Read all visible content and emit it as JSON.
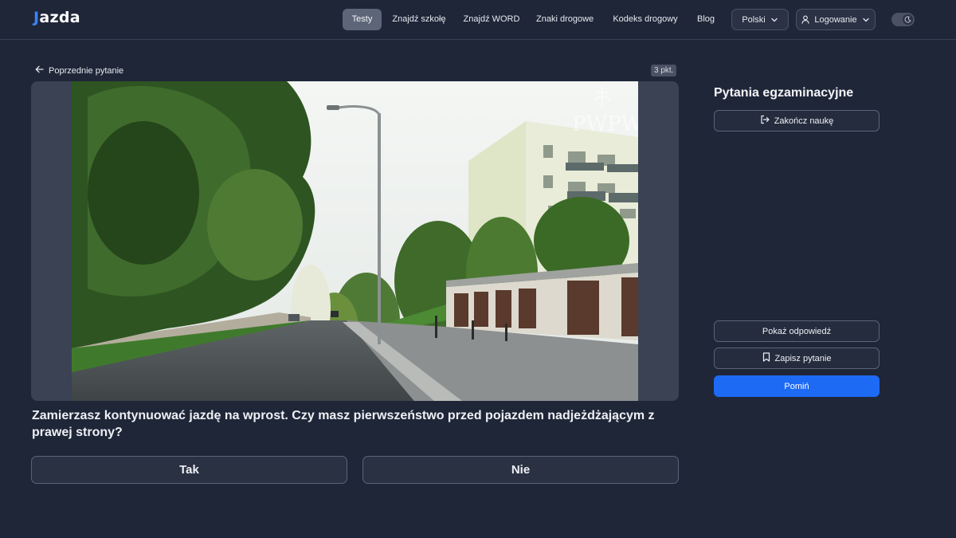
{
  "header": {
    "logo": {
      "prefix": "J",
      "rest": "azda"
    },
    "nav": [
      {
        "label": "Testy",
        "active": true
      },
      {
        "label": "Znajdź szkołę",
        "active": false
      },
      {
        "label": "Znajdź WORD",
        "active": false
      },
      {
        "label": "Znaki drogowe",
        "active": false
      },
      {
        "label": "Kodeks drogowy",
        "active": false
      },
      {
        "label": "Blog",
        "active": false
      }
    ],
    "language": "Polski",
    "login": "Logowanie",
    "theme": "dark"
  },
  "question_view": {
    "back_label": "Poprzednie pytanie",
    "points": "3 pkt.",
    "media_watermark": "PWPW",
    "question": "Zamierzasz kontynuować jazdę na wprost. Czy masz pierwszeństwo przed pojazdem nadjeżdżającym z prawej strony?",
    "answers": [
      "Tak",
      "Nie"
    ]
  },
  "sidebar": {
    "title": "Pytania egzaminacyjne",
    "finish_label": "Zakończ naukę",
    "show_answer_label": "Pokaż odpowiedź",
    "save_label": "Zapisz pytanie",
    "skip_label": "Pomiń"
  },
  "colors": {
    "background": "#1f2638",
    "primary": "#1d6af5",
    "active_nav": "#5d6579"
  }
}
